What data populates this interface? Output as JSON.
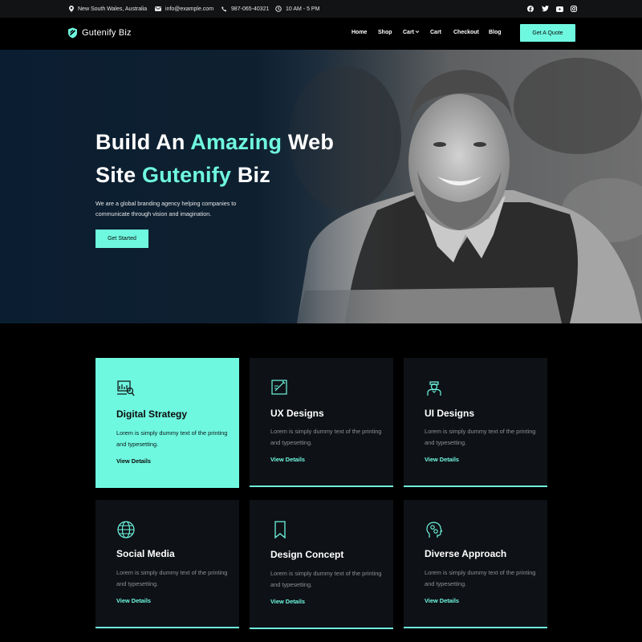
{
  "topbar": {
    "location": "New South Wales, Australia",
    "email": "info@example.com",
    "phone": "987-065-40321",
    "hours": "10 AM - 5 PM",
    "social_icons": [
      "facebook-icon",
      "twitter-icon",
      "youtube-icon",
      "instagram-icon"
    ]
  },
  "header": {
    "brand": "Gutenify Biz",
    "nav": [
      "Home",
      "Shop",
      "Cart",
      "Cart",
      "Checkout",
      "Blog"
    ],
    "cta": "Get A Quote"
  },
  "hero": {
    "line1_a": "Build An ",
    "line1_accent": "Amazing",
    "line1_b": " Web",
    "line2_a": "Site ",
    "line2_accent": "Gutenify",
    "line2_b": " Biz",
    "subtitle": "We are a global branding agency helping companies to communicate through vision and imagination.",
    "button": "Get Started"
  },
  "services": [
    {
      "title": "Digital Strategy",
      "text": "Lorem is simply dummy text of the printing and typesetting.",
      "link": "View Details",
      "icon": "analytics-icon"
    },
    {
      "title": "UX Designs",
      "text": "Lorem is simply dummy text of the printing and typesetting.",
      "link": "View Details",
      "icon": "design-tablet-icon"
    },
    {
      "title": "UI Designs",
      "text": "Lorem is simply dummy text of the printing and typesetting.",
      "link": "View Details",
      "icon": "designer-icon"
    },
    {
      "title": "Social Media",
      "text": "Lorem is simply dummy text of the printing and typesetting.",
      "link": "View Details",
      "icon": "globe-icon"
    },
    {
      "title": "Design Concept",
      "text": "Lorem is simply dummy text of the printing and typesetting.",
      "link": "View Details",
      "icon": "bookmark-icon"
    },
    {
      "title": "Diverse Approach",
      "text": "Lorem is simply dummy text of the printing and typesetting.",
      "link": "View Details",
      "icon": "mind-gears-icon"
    }
  ],
  "colors": {
    "accent": "#6ff8e0",
    "card": "#0e1116",
    "background": "#000000"
  }
}
